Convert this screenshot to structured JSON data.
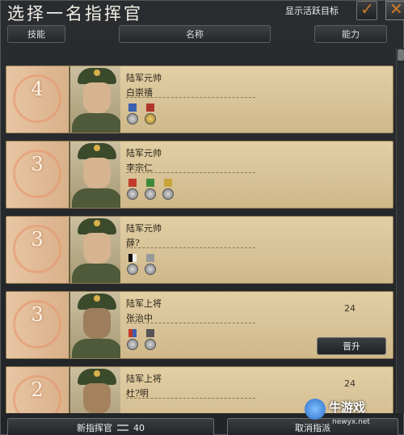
{
  "window": {
    "title": "选择一名指挥官",
    "active_target_label": "显示活跃目标",
    "check_glyph": "✓",
    "close_glyph": "✕"
  },
  "columns": {
    "skill": "技能",
    "name": "名称",
    "ability": "能力"
  },
  "commanders": [
    {
      "skill": "4",
      "rank": "陆军元帅",
      "name": "白崇禧",
      "ability": "",
      "medals": [
        "blue",
        "red-gold"
      ],
      "promote": ""
    },
    {
      "skill": "3",
      "rank": "陆军元帅",
      "name": "李宗仁",
      "ability": "",
      "medals": [
        "red",
        "green",
        "silver"
      ],
      "promote": ""
    },
    {
      "skill": "3",
      "rank": "陆军元帅",
      "name": "薛?",
      "ability": "",
      "medals": [
        "black-white",
        "silver"
      ],
      "promote": ""
    },
    {
      "skill": "3",
      "rank": "陆军上将",
      "name": "张治中",
      "ability": "24",
      "medals": [
        "red-blue",
        "silver"
      ],
      "promote": "晋升"
    },
    {
      "skill": "2",
      "rank": "陆军上将",
      "name": "杜?明",
      "ability": "24",
      "medals": [],
      "promote": ""
    }
  ],
  "footer": {
    "new_commander": "新指挥官",
    "new_commander_cost": "40",
    "cancel_assignment": "取消指派"
  },
  "watermark": {
    "text": "牛游戏",
    "url": "newyx.net"
  },
  "colors": {
    "card_bg": "#d7c196",
    "skill_bg": "#e0bb95",
    "check_accent": "#d07a2a"
  }
}
